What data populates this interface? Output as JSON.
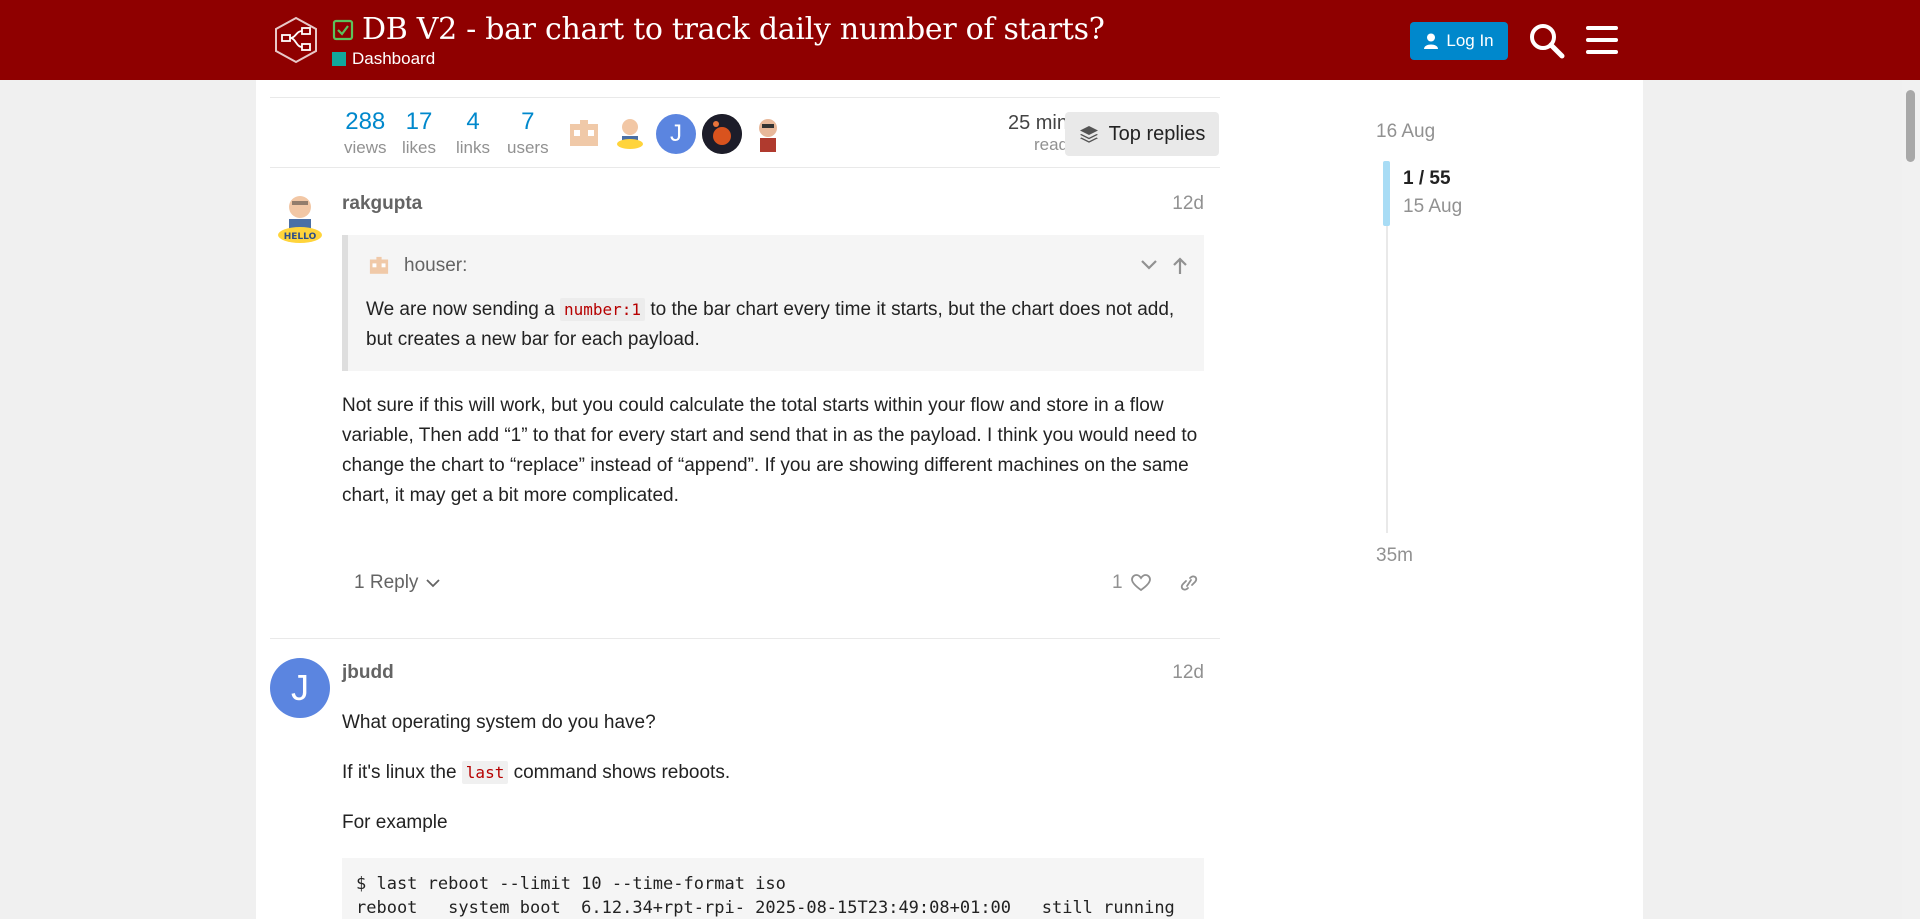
{
  "header": {
    "title": "DB V2 - bar chart to track daily number of starts?",
    "category": "Dashboard",
    "login_label": "Log In",
    "colors": {
      "header_bg": "#8f0000",
      "category": "#12a89d",
      "login": "#0088cc"
    }
  },
  "topic_map": {
    "stats": [
      {
        "value": "288",
        "label": "views"
      },
      {
        "value": "17",
        "label": "likes"
      },
      {
        "value": "4",
        "label": "links"
      },
      {
        "value": "7",
        "label": "users"
      }
    ],
    "avatar_letter": "J",
    "read_time": "25 min",
    "read_label": "read",
    "top_replies_label": "Top replies"
  },
  "posts": [
    {
      "username": "rakgupta",
      "date": "12d",
      "quote": {
        "author": "houser:",
        "text_before": "We are now sending a ",
        "code": "number:1",
        "text_after": " to the bar chart every time it starts, but the chart does not add, but creates a new bar for each payload."
      },
      "body": "Not sure if this will work, but you could calculate the total starts within your flow and store in a flow variable, Then add “1” to that for every start and send that in as the payload. I think you would need to change the chart to “replace” instead of “append”. If you are showing different machines on the same chart, it may get a bit more complicated.",
      "reply_label": "1 Reply",
      "like_count": "1"
    },
    {
      "username": "jbudd",
      "avatar_letter": "J",
      "date": "12d",
      "p1": "What operating system do you have?",
      "p2_before": "If it's linux the ",
      "p2_code": "last",
      "p2_after": " command shows reboots.",
      "p3": "For example",
      "code_line1": "$ last reboot --limit 10 --time-format iso",
      "code_line2": "reboot   system boot  6.12.34+rpt-rpi- 2025-08-15T23:49:08+01:00   still running"
    }
  ],
  "timeline": {
    "top": "16 Aug",
    "position": "1 / 55",
    "date": "15 Aug",
    "bottom": "35m"
  }
}
